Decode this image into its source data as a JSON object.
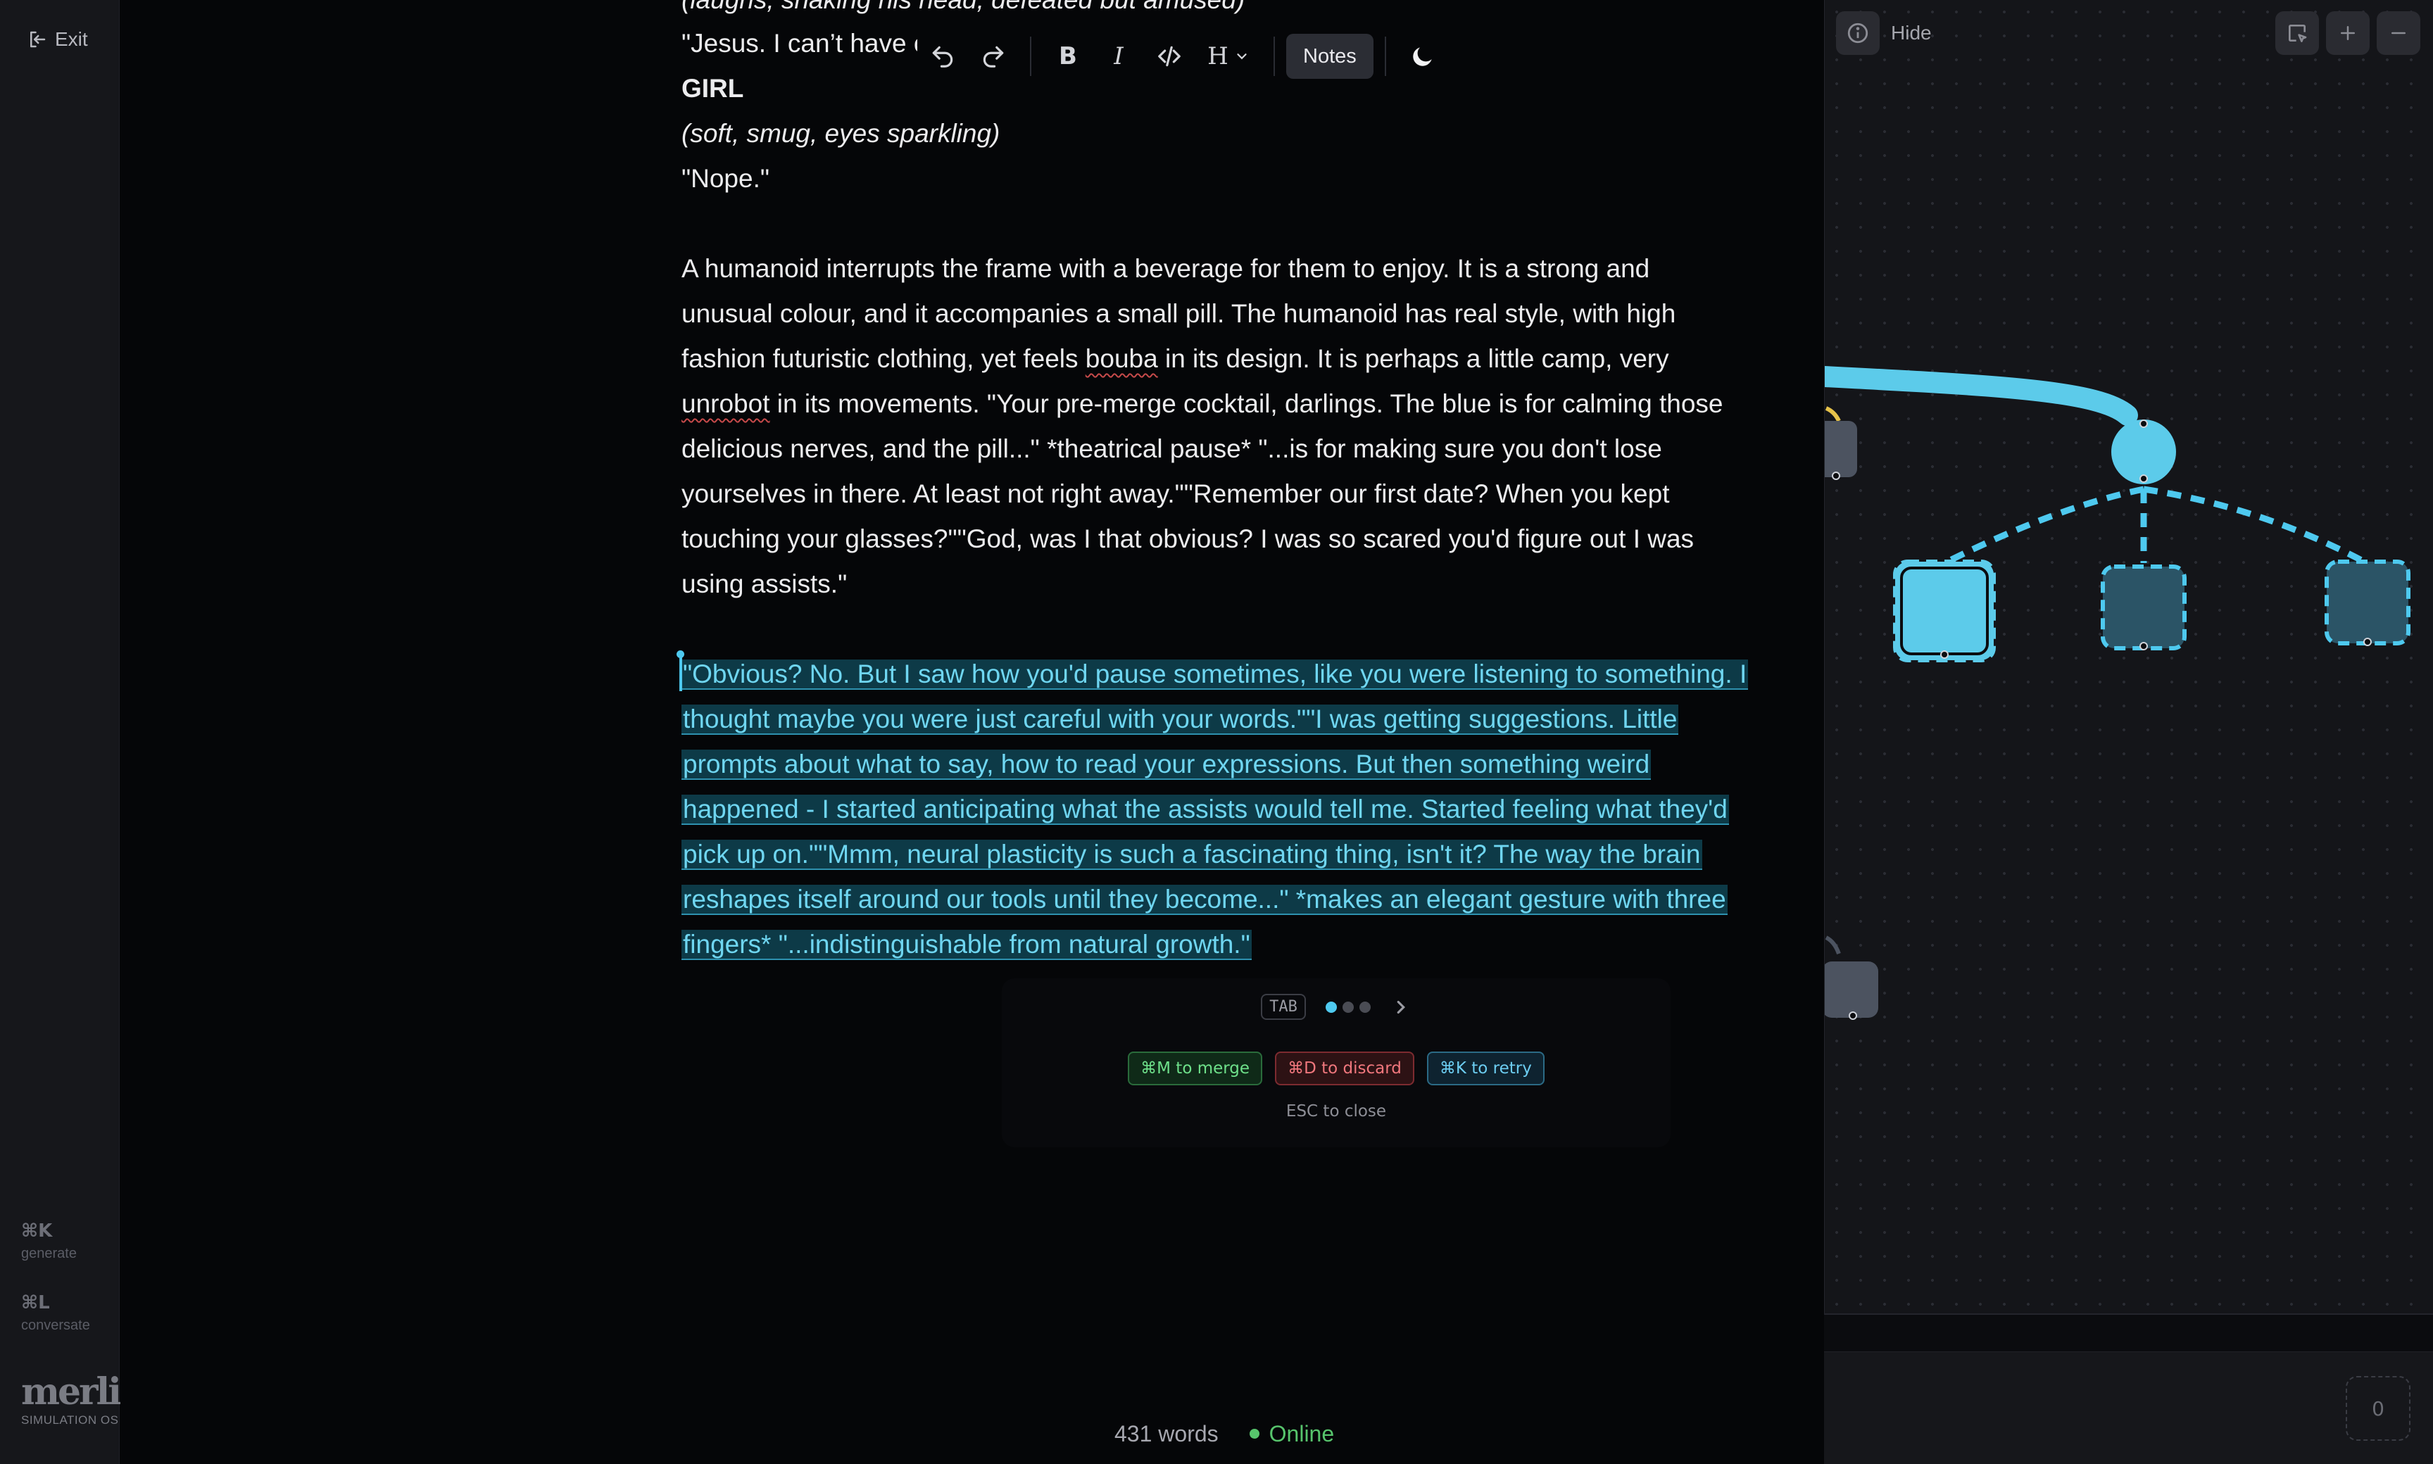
{
  "rail": {
    "exit_label": "Exit",
    "shortcuts": [
      {
        "key": "⌘K",
        "label": "generate"
      },
      {
        "key": "⌘L",
        "label": "conversate"
      }
    ],
    "logo_word": "merlin",
    "logo_sub": "SIMULATION OS"
  },
  "toolbar": {
    "undo_icon": "undo-icon",
    "redo_icon": "redo-icon",
    "bold_label": "B",
    "italic_label": "I",
    "heading_label": "H",
    "notes_label": "Notes"
  },
  "doc": {
    "line_top": "(laughs, shaking his head, defeated but amused)",
    "line_jesus_a": "\"Jesus. I can’t have o",
    "line_girl": "GIRL",
    "line_direction": "(soft, smug, eyes sparkling)",
    "line_nope": "\"Nope.\"",
    "para1": {
      "l1": "A humanoid interrupts the frame with a beverage for them to enjoy. It is a strong and",
      "l2": "unusual colour, and it accompanies a small pill. The humanoid has real style, with high",
      "l3_a": "fashion futuristic clothing, yet feels ",
      "l3_b": "bouba",
      "l3_c": " in its design. It is perhaps a little camp, very",
      "l4_a": "unrobot",
      "l4_b": " in its movements. \"Your pre-merge cocktail, darlings. The blue is for calming those",
      "l5": "delicious nerves, and the pill...\" *theatrical pause* \"...is for making sure you don't lose",
      "l6": "yourselves in there. At least not right away.\"\"Remember our first date? When you kept",
      "l7": "touching your glasses?\"\"God, was I that obvious? I was so scared you'd figure out I was",
      "l8": "using assists.\""
    },
    "suggestion": {
      "l1": "\"Obvious? No. But I saw how you'd pause sometimes, like you were listening to something. I",
      "l2": "thought maybe you were just careful with your words.\"\"I was getting suggestions. Little",
      "l3": "prompts about what to say, how to read your expressions. But then something weird",
      "l4": "happened - I started anticipating what the assists would tell me. Started feeling what they'd",
      "l5": "pick up on.\"\"Mmm, neural plasticity is such a fascinating thing, isn't it? The way the brain",
      "l6": "reshapes itself around our tools until they become...\" *makes an elegant gesture with three",
      "l7": "fingers* \"...indistinguishable from natural growth.\""
    }
  },
  "suggest": {
    "tab_key": "TAB",
    "variant_count": 3,
    "variant_active": 1,
    "merge_label": "⌘M to merge",
    "discard_label": "⌘D to discard",
    "retry_label": "⌘K to retry",
    "esc_label": "ESC to close"
  },
  "status": {
    "word_count": "431 words",
    "connection": "Online"
  },
  "panel": {
    "hide_label": "Hide",
    "count": "0"
  },
  "colors": {
    "accent": "#4ec9ef",
    "online": "#57c46c",
    "discard": "#f0777d",
    "merge": "#6ee08a"
  }
}
